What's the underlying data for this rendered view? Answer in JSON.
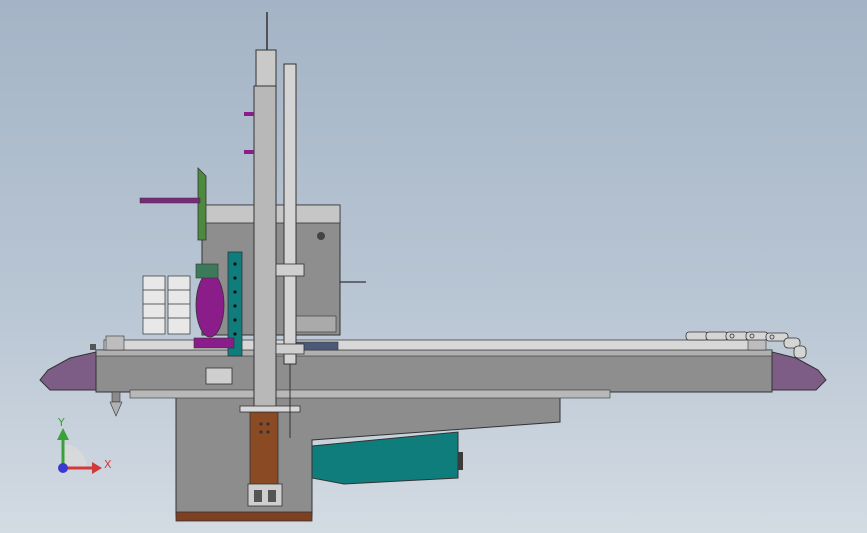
{
  "viewport": {
    "background_top": "#a4b4c6",
    "background_bottom": "#d3dbe3"
  },
  "colors": {
    "frame_gray": "#8d8d8d",
    "frame_dark": "#707070",
    "bed_light": "#cfcfcf",
    "end_cap_purple": "#7d5c86",
    "teal_guard": "#0e7d7c",
    "green_bracket": "#4c8a3e",
    "magenta_part": "#8a1d8a",
    "wood_brown": "#8a4a24",
    "column_light": "#c9c9c9"
  },
  "triad": {
    "x_axis_label": "X",
    "y_axis_label": "Y",
    "x_color": "#d03a3a",
    "y_color": "#3aa03a",
    "z_color": "#3a3ad0",
    "icons": [
      "axis-x-arrow-icon",
      "axis-y-arrow-icon",
      "axis-origin-icon"
    ]
  }
}
